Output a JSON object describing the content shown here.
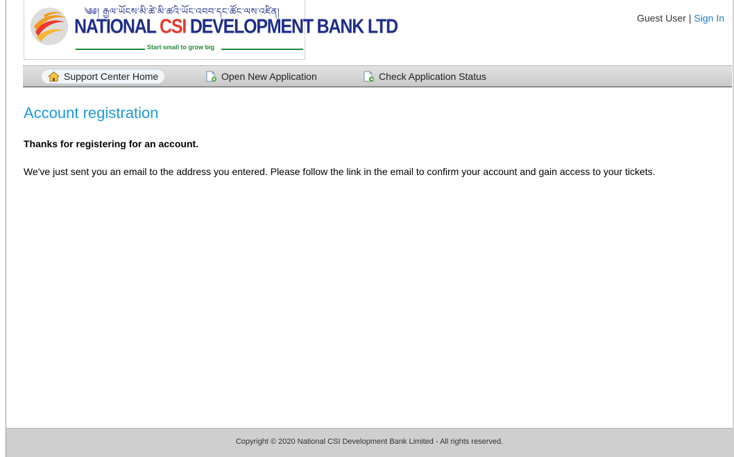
{
  "header": {
    "logo": {
      "tibetan_text": "༄༅། རྒྱལ་ཡོངས་མི་ཚེ་མི་ཚའི་ཡོང་འབབ་དང་ཚོང་ལས་འཛིན།",
      "name_part1": "NATIONAL ",
      "name_part2": "CSI",
      "name_part3": " DEVELOPMENT BANK LTD",
      "tagline": "Start small to grow big",
      "icon": "ribbon-logo-icon",
      "colors": {
        "navy": "#1f2d8a",
        "red": "#e8392d",
        "green": "#1e8a3a",
        "orange": "#f39a1f"
      }
    },
    "user": {
      "guest_label": "Guest User",
      "separator": "|",
      "sign_in_label": "Sign In"
    }
  },
  "nav": {
    "items": [
      {
        "label": "Support Center Home",
        "icon": "home-icon",
        "active": true
      },
      {
        "label": "Open New Application",
        "icon": "new-document-icon",
        "active": false
      },
      {
        "label": "Check Application Status",
        "icon": "document-status-icon",
        "active": false
      }
    ]
  },
  "main": {
    "title": "Account registration",
    "thanks": "Thanks for registering for an account.",
    "message": "We've just sent you an email to the address you entered. Please follow the link in the email to confirm your account and gain access to your tickets."
  },
  "footer": {
    "copyright": "Copyright © 2020 National CSI Development Bank Limited - All rights reserved."
  },
  "colors": {
    "accent": "#1a9ae0",
    "link": "#1a7ec5",
    "footer_bg": "#cfcfcf",
    "nav_bg": "#d4d4d4"
  }
}
